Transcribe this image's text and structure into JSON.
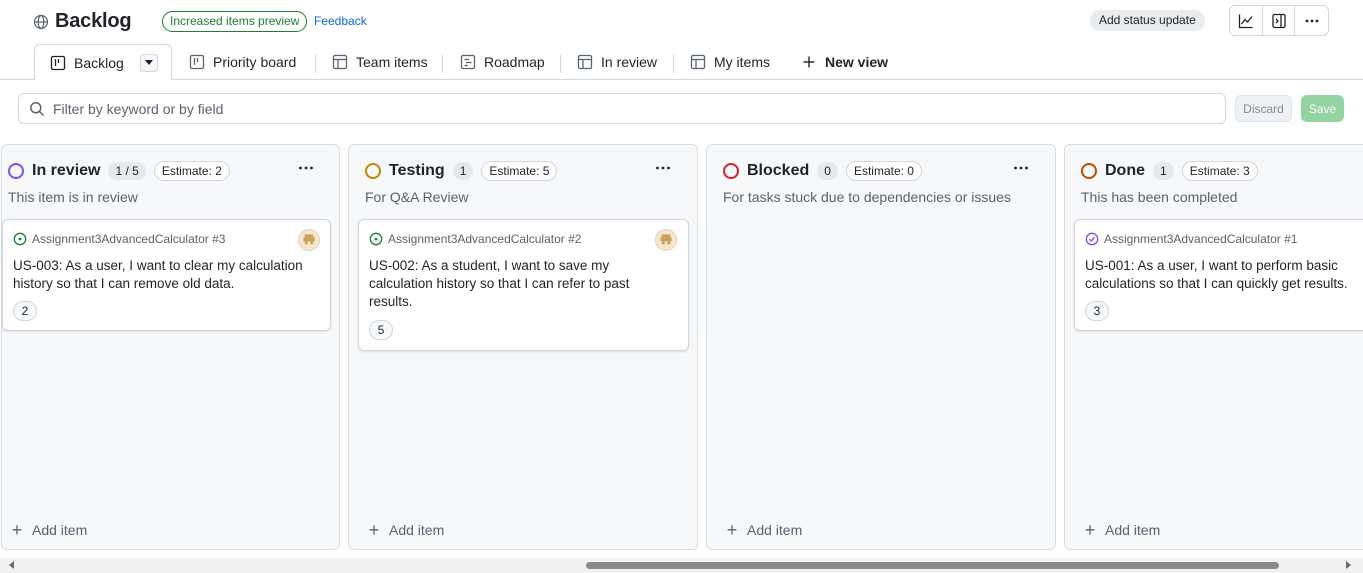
{
  "header": {
    "title": "Backlog",
    "preview_badge": "Increased items preview",
    "feedback": "Feedback",
    "status_update": "Add status update"
  },
  "tabs": [
    {
      "label": "Backlog",
      "icon": "board-icon",
      "active": true
    },
    {
      "label": "Priority board",
      "icon": "board-icon"
    },
    {
      "label": "Team items",
      "icon": "table-icon"
    },
    {
      "label": "Roadmap",
      "icon": "roadmap-icon"
    },
    {
      "label": "In review",
      "icon": "table-icon"
    },
    {
      "label": "My items",
      "icon": "table-icon"
    },
    {
      "label": "New view",
      "icon": "plus-icon"
    }
  ],
  "filter": {
    "placeholder": "Filter by keyword or by field",
    "discard": "Discard",
    "save": "Save"
  },
  "columns": [
    {
      "name": "In review",
      "count": "1 / 5",
      "estimate": "Estimate: 2",
      "description": "This item is in review",
      "ring_color": "#8250df",
      "add_item": "Add item",
      "cards": [
        {
          "repo": "Assignment3AdvancedCalculator #3",
          "title": "US-003: As a user, I want to clear my calculation history so that I can remove old data.",
          "estimate": "2",
          "status": "open"
        }
      ]
    },
    {
      "name": "Testing",
      "count": "1",
      "estimate": "Estimate: 5",
      "description": "For Q&A Review",
      "ring_color": "#bf8700",
      "add_item": "Add item",
      "cards": [
        {
          "repo": "Assignment3AdvancedCalculator #2",
          "title": "US-002: As a student, I want to save my calculation history so that I can refer to past results.",
          "estimate": "5",
          "status": "open"
        }
      ]
    },
    {
      "name": "Blocked",
      "count": "0",
      "estimate": "Estimate: 0",
      "description": "For tasks stuck due to dependencies or issues",
      "ring_color": "#cf222e",
      "add_item": "Add item",
      "cards": []
    },
    {
      "name": "Done",
      "count": "1",
      "estimate": "Estimate: 3",
      "description": "This has been completed",
      "ring_color": "#bc4c00",
      "add_item": "Add item",
      "cards": [
        {
          "repo": "Assignment3AdvancedCalculator #1",
          "title": "US-001: As a user, I want to perform basic calculations so that I can quickly get results.",
          "estimate": "3",
          "status": "closed"
        }
      ]
    }
  ],
  "colors": {
    "open": "#1a7f37",
    "closed": "#8250df",
    "link": "#0969da",
    "save_disabled": "#94d3a2"
  }
}
